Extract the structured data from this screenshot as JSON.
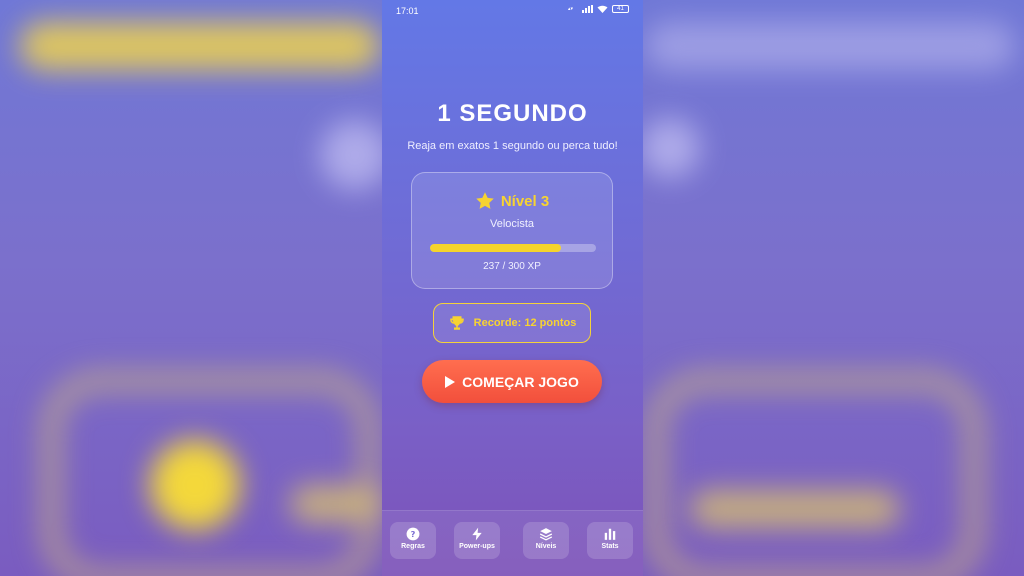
{
  "status_bar": {
    "time": "17:01",
    "battery": "41"
  },
  "game": {
    "title": "1 SEGUNDO",
    "subtitle": "Reaja em exatos 1 segundo ou perca tudo!"
  },
  "level_card": {
    "level_label": "Nível 3",
    "rank": "Velocista",
    "xp_text": "237 / 300 XP",
    "xp_progress": 0.79
  },
  "record": {
    "label": "Recorde: 12 pontos"
  },
  "start_button": {
    "label": "COMEÇAR JOGO"
  },
  "nav": {
    "items": [
      {
        "label": "Regras",
        "icon": "help-icon"
      },
      {
        "label": "Power-ups",
        "icon": "bolt-icon"
      },
      {
        "label": "Níveis",
        "icon": "layers-icon"
      },
      {
        "label": "Stats",
        "icon": "bar-chart-icon"
      }
    ]
  },
  "colors": {
    "accent_yellow": "#f7d331",
    "start_button": "#f24f3c",
    "phone_top": "#6378e6",
    "phone_bottom": "#7c52b8"
  }
}
